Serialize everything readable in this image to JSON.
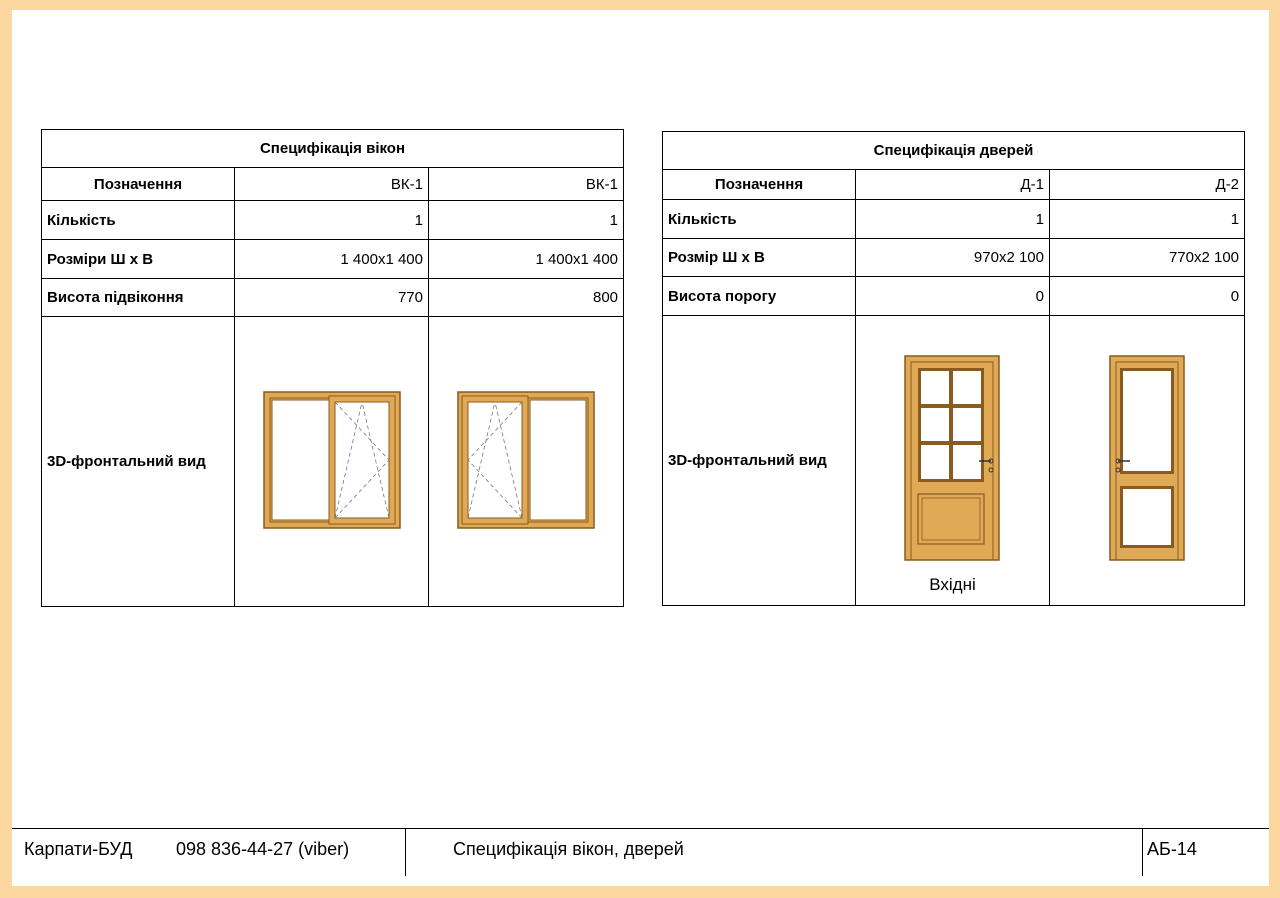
{
  "colors": {
    "frame_border": "#fdd7a0",
    "wood": "#e0a955",
    "wood_dark": "#8a5a1e",
    "glass": "#ffffff"
  },
  "windows": {
    "title": "Специфікація вікон",
    "label_designation": "Позначення",
    "label_quantity": "Кількість",
    "label_size": "Розміри Ш х В",
    "label_sill": "Висота підвіконня",
    "label_view": "3D-фронтальний вид",
    "items": [
      {
        "designation": "ВК-1",
        "quantity": "1",
        "size": "1 400х1 400",
        "sill": "770",
        "drawing": "two-sash-window-right-tilt"
      },
      {
        "designation": "ВК-1",
        "quantity": "1",
        "size": "1 400х1 400",
        "sill": "800",
        "drawing": "two-sash-window-left-tilt"
      }
    ]
  },
  "doors": {
    "title": "Специфікація дверей",
    "label_designation": "Позначення",
    "label_quantity": "Кількість",
    "label_size": "Розмір Ш х В",
    "label_threshold": "Висота порогу",
    "label_view": "3D-фронтальний вид",
    "items": [
      {
        "designation": "Д-1",
        "quantity": "1",
        "size": "970х2 100",
        "threshold": "0",
        "caption": "Вхідні",
        "drawing": "glazed-panel-door"
      },
      {
        "designation": "Д-2",
        "quantity": "1",
        "size": "770х2 100",
        "threshold": "0",
        "caption": "",
        "drawing": "two-panel-glazed-door"
      }
    ]
  },
  "footer": {
    "company": "Карпати-БУД",
    "phone": "098 836-44-27 (viber)",
    "sheet_title": "Специфікація вікон, дверей",
    "sheet_number": "АБ-14"
  }
}
